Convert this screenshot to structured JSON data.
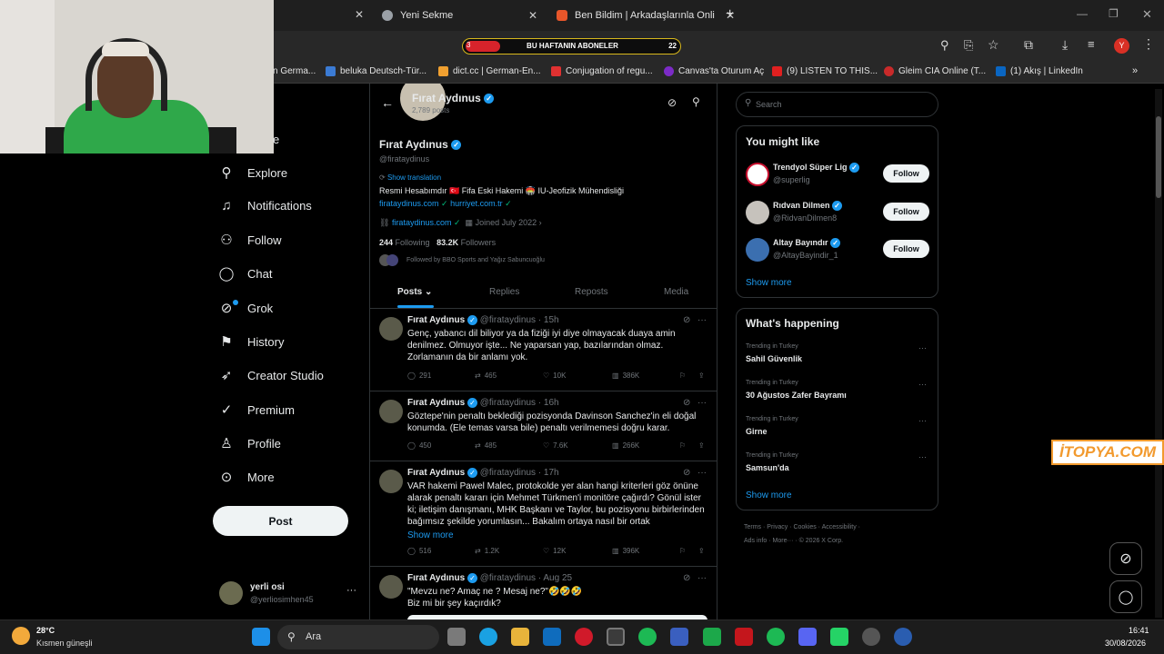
{
  "browser": {
    "tabs": [
      {
        "label": "Yeni Sekme"
      },
      {
        "label": "Ben Bildim | Arkadaşlarınla Onli"
      }
    ],
    "banner": {
      "left": "3",
      "text": "BU HAFTANIN ABONELER",
      "right": "22"
    },
    "profile_initial": "Y",
    "bookmarks": [
      "n Germa...",
      "beluka Deutsch-Tür...",
      "dict.cc | German-En...",
      "Conjugation of regu...",
      "Canvas'ta Oturum Aç",
      "(9) LISTEN TO THIS...",
      "Gleim CIA Online (T...",
      "(1) Akış | LinkedIn"
    ]
  },
  "nav": {
    "partial_label": "e",
    "items": [
      {
        "icon": "search-icon",
        "glyph": "⚲",
        "label": "Explore"
      },
      {
        "icon": "bell-icon",
        "glyph": "🔔",
        "label": "Notifications"
      },
      {
        "icon": "follow-icon",
        "glyph": "👤",
        "label": "Follow"
      },
      {
        "icon": "chat-icon",
        "glyph": "💬",
        "label": "Chat"
      },
      {
        "icon": "grok-icon",
        "glyph": "⊘",
        "label": "Grok"
      },
      {
        "icon": "bookmark-icon",
        "glyph": "🔖",
        "label": "History"
      },
      {
        "icon": "rocket-icon",
        "glyph": "🚀",
        "label": "Creator Studio"
      },
      {
        "icon": "premium-icon",
        "glyph": "✓",
        "label": "Premium"
      },
      {
        "icon": "profile-icon",
        "glyph": "👤",
        "label": "Profile"
      },
      {
        "icon": "more-icon",
        "glyph": "⋯",
        "label": "More"
      }
    ],
    "post_label": "Post",
    "account": {
      "name": "yerli osi",
      "handle": "@yerliosimhen45"
    }
  },
  "profile": {
    "header_name": "Fırat Aydınus",
    "header_posts": "2,789 posts",
    "name": "Fırat Aydınus",
    "handle": "@firataydinus",
    "show_translation": "Show translation",
    "bio": "Resmi Hesabımdır 🇹🇷 Fifa Eski Hakemi 🏟️ IU-Jeofizik Mühendisliği",
    "bio_link1": "firataydinus.com",
    "bio_link2": "hurriyet.com.tr",
    "website": "firataydinus.com",
    "joined": "Joined July 2022",
    "following_count": "244",
    "following_label": "Following",
    "followers_count": "83.2K",
    "followers_label": "Followers",
    "followed_by": "Followed by BBO Sports and Yağız Sabuncuoğlu",
    "tabs": [
      "Posts",
      "Replies",
      "Reposts",
      "Media"
    ]
  },
  "tweets": [
    {
      "name": "Fırat Aydınus",
      "handle": "@firataydinus",
      "time": "15h",
      "text": "Genç, yabancı dil biliyor ya da fiziği iyi diye olmayacak duaya amin denilmez. Olmuyor işte... Ne yaparsan yap, bazılarından olmaz. Zorlamanın da bir anlamı yok.",
      "replies": "291",
      "reposts": "465",
      "likes": "10K",
      "views": "386K",
      "show_more": ""
    },
    {
      "name": "Fırat Aydınus",
      "handle": "@firataydinus",
      "time": "16h",
      "text": "Göztepe'nin penaltı beklediği pozisyonda Davinson Sanchez'in eli doğal konumda. (Ele temas varsa bile) penaltı verilmemesi doğru karar.",
      "replies": "450",
      "reposts": "485",
      "likes": "7.6K",
      "views": "266K",
      "show_more": ""
    },
    {
      "name": "Fırat Aydınus",
      "handle": "@firataydinus",
      "time": "17h",
      "text": "VAR hakemi Pawel Malec, protokolde yer alan hangi kriterleri göz önüne alarak penaltı kararı için Mehmet Türkmen'i monitöre çağırdı? Gönül ister ki; iletişim danışmanı, MHK Başkanı ve Taylor, bu pozisyonu birbirlerinden bağımsız şekilde yorumlasın... Bakalım ortaya nasıl bir ortak",
      "replies": "516",
      "reposts": "1.2K",
      "likes": "12K",
      "views": "396K",
      "show_more": "Show more"
    },
    {
      "name": "Fırat Aydınus",
      "handle": "@firataydinus",
      "time": "Aug 25",
      "text": "\"Mevzu ne? Amaç ne ? Mesaj ne?\"🤣🤣🤣 Biz mi bir şey kaçırdık?",
      "replies": "",
      "reposts": "",
      "likes": "",
      "views": "",
      "show_more": ""
    }
  ],
  "right": {
    "search_placeholder": "Search",
    "you_might_like": "You might like",
    "suggestions": [
      {
        "name": "Trendyol Süper Lig",
        "handle": "@superlig",
        "button": "Follow"
      },
      {
        "name": "Rıdvan Dilmen",
        "handle": "@RidvanDilmen8",
        "button": "Follow"
      },
      {
        "name": "Altay Bayındır",
        "handle": "@AltayBayindir_1",
        "button": "Follow"
      }
    ],
    "show_more": "Show more",
    "whats_happening": "What's happening",
    "trends": [
      {
        "context": "Trending in Turkey",
        "title": "Sahil Güvenlik"
      },
      {
        "context": "Trending in Turkey",
        "title": "30 Ağustos Zafer Bayramı"
      },
      {
        "context": "Trending in Turkey",
        "title": "Girne"
      },
      {
        "context": "Trending in Turkey",
        "title": "Samsun'da"
      }
    ],
    "show_more2": "Show more",
    "footer1": "Terms · Privacy · Cookies · Accessibility ·",
    "footer2": "Ads info · More··· · © 2026 X Corp."
  },
  "watermark": "İTOPYA.COM",
  "taskbar": {
    "weather_temp": "28°C",
    "weather_desc": "Kısmen güneşli",
    "search": "Ara",
    "time": "16:41",
    "date": "30/08/2026"
  },
  "colors": {
    "accent": "#1d9bf0",
    "background": "#000000",
    "border": "#2f3336"
  }
}
